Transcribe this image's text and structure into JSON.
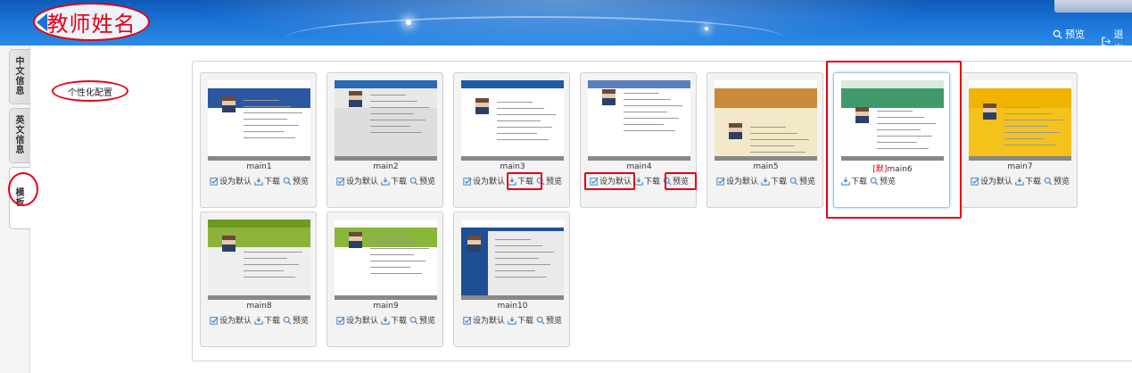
{
  "header": {
    "title": "教师姓名",
    "preview_label": "预览",
    "logout_label": "退出"
  },
  "vtabs": [
    {
      "label": "中文信息"
    },
    {
      "label": "英文信息"
    },
    {
      "label": "模板"
    }
  ],
  "submenu": {
    "label": "个性化配置"
  },
  "labels": {
    "set_default": "设为默认",
    "download": "下载",
    "preview": "预览",
    "default_tag": "[默]"
  },
  "templates": [
    {
      "name": "main1",
      "is_default": false
    },
    {
      "name": "main2",
      "is_default": false
    },
    {
      "name": "main3",
      "is_default": false
    },
    {
      "name": "main4",
      "is_default": false
    },
    {
      "name": "main5",
      "is_default": false
    },
    {
      "name": "main6",
      "is_default": true
    },
    {
      "name": "main7",
      "is_default": false
    },
    {
      "name": "main8",
      "is_default": false
    },
    {
      "name": "main9",
      "is_default": false
    },
    {
      "name": "main10",
      "is_default": false
    }
  ],
  "colors": {
    "accent_red": "#e60012",
    "header_blue": "#1a73d6",
    "selected_border": "#9bc7e8"
  }
}
